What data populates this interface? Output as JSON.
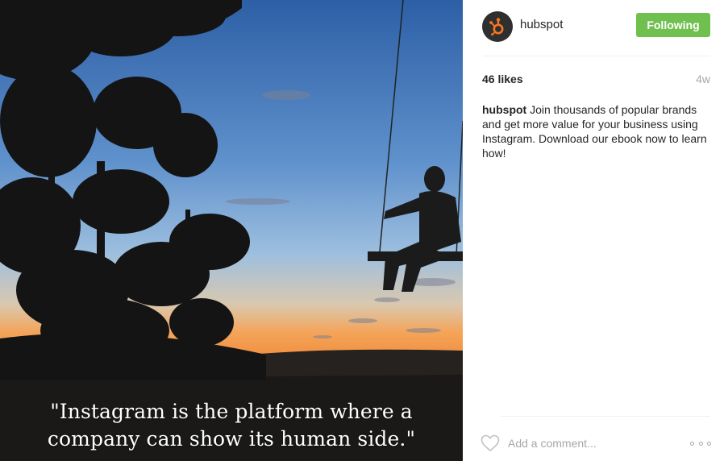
{
  "post": {
    "quote_line1": "\"Instagram is the platform where a",
    "quote_line2": "company can show its human side.\""
  },
  "profile": {
    "username": "hubspot",
    "avatar_icon": "hubspot-sprocket-icon",
    "brand_color": "#f57722",
    "follow_label": "Following",
    "follow_color": "#70c050"
  },
  "stats": {
    "likes": "46 likes",
    "age": "4w"
  },
  "caption": {
    "author": "hubspot",
    "text": " Join thousands of popular brands and get more value for your business using Instagram. Download our ebook now to learn how!"
  },
  "comment": {
    "placeholder": "Add a comment...",
    "like_icon": "heart-outline-icon",
    "more_icon": "more-options-icon"
  }
}
